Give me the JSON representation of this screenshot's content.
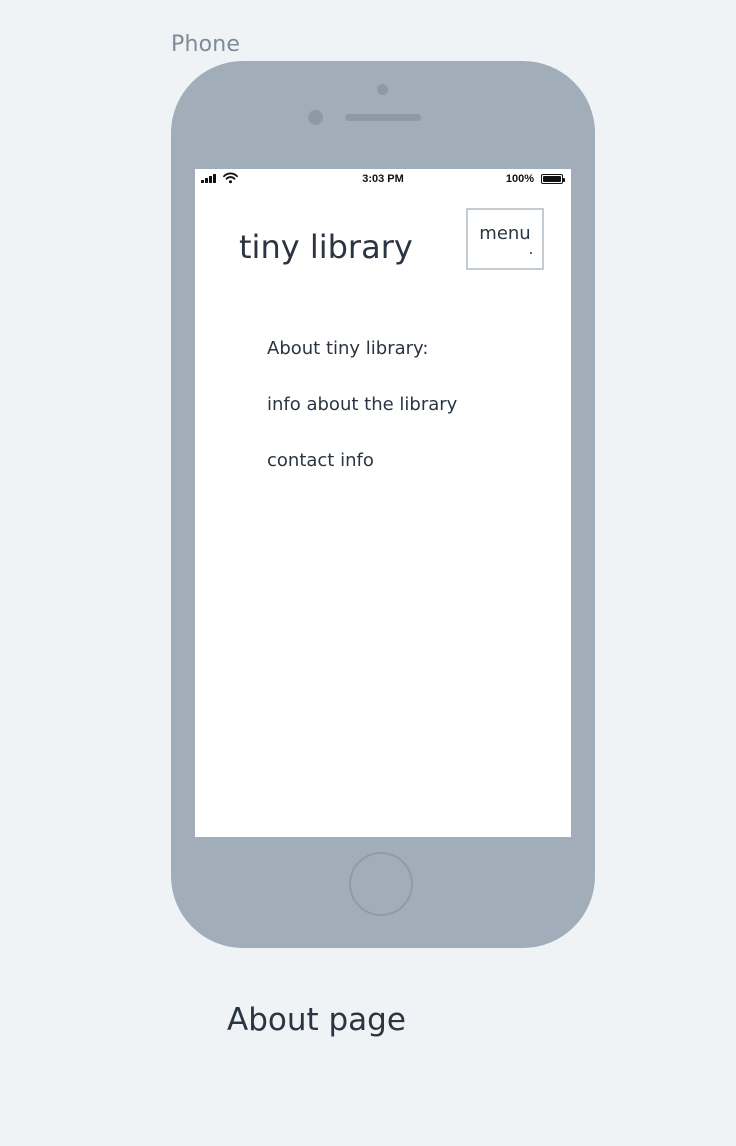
{
  "artboard": {
    "label": "Phone",
    "caption": "About page"
  },
  "status_bar": {
    "time": "3:03 PM",
    "battery_percent": "100%",
    "battery_level": 1.0,
    "signal_icon": "cellular-signal-icon",
    "wifi_icon": "wifi-icon",
    "battery_icon": "battery-icon"
  },
  "header": {
    "title": "tiny library",
    "menu_label": "menu"
  },
  "about": {
    "items": [
      {
        "label": "About tiny library:"
      },
      {
        "label": "info about the library"
      },
      {
        "label": "contact info"
      }
    ]
  },
  "colors": {
    "background": "#eff3f6",
    "device": "#a1adb8",
    "text": "#2b3542",
    "muted_text": "#7e8b98",
    "menu_border": "#c4ccd3"
  }
}
